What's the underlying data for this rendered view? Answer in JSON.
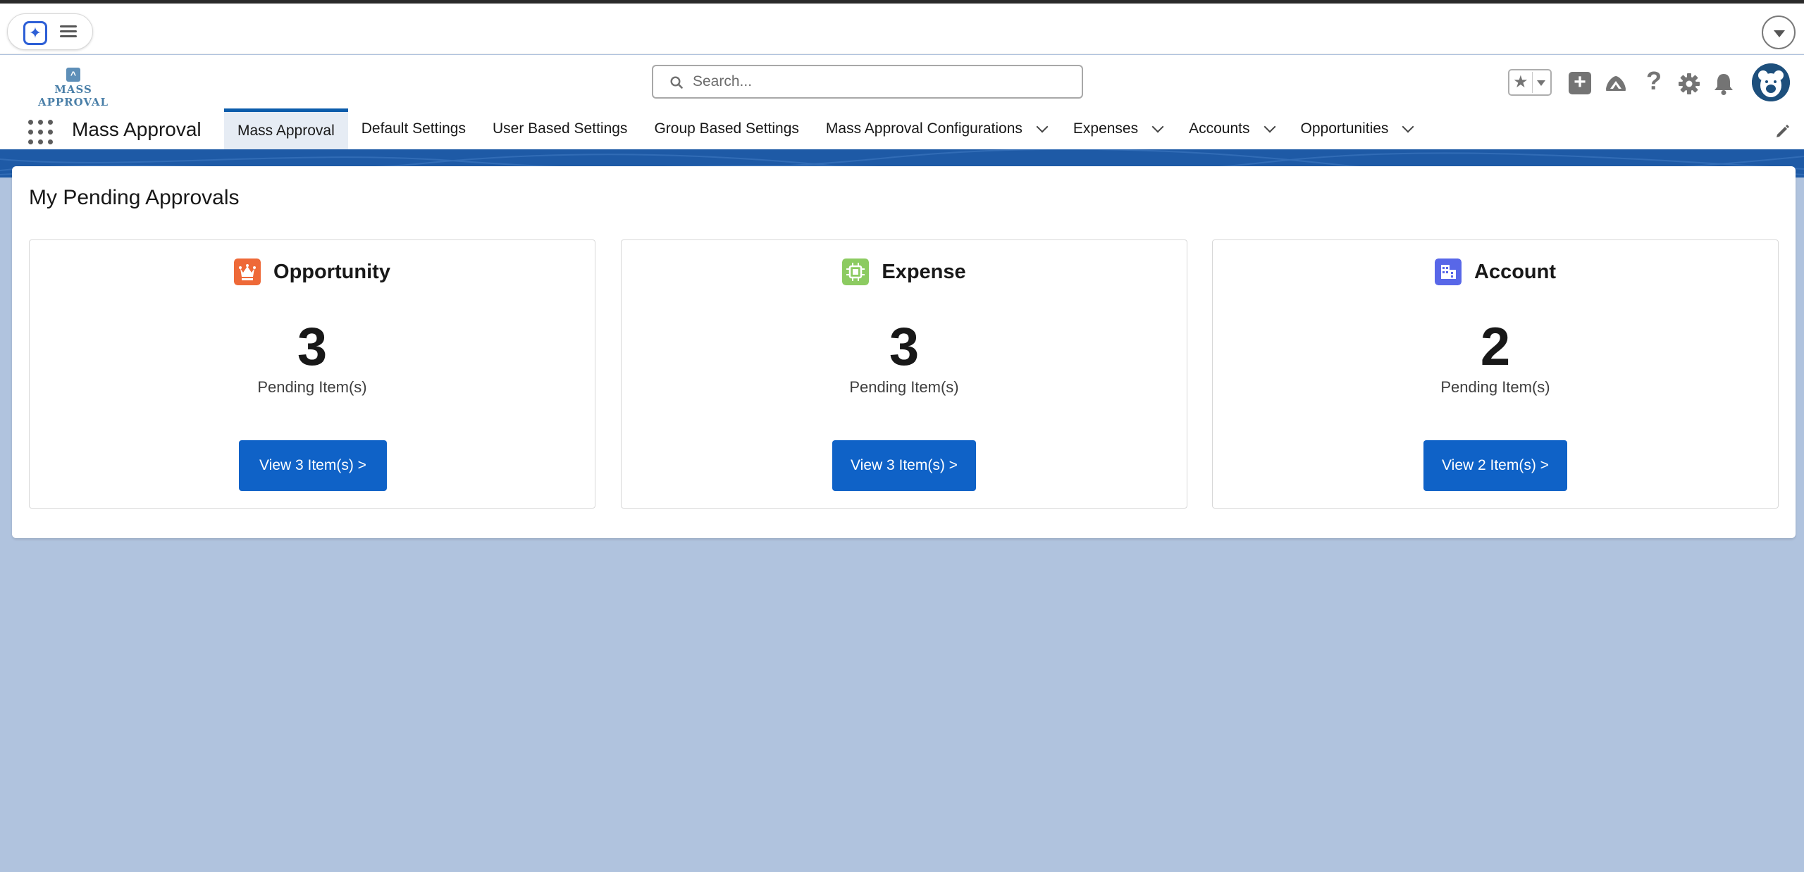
{
  "browser": {
    "extension_icon": "sparkle-logo-icon",
    "menu_icon": "hamburger-icon",
    "dropdown_icon": "chevron-down-circle-icon"
  },
  "header": {
    "logo_text": "MASS APPROVAL",
    "search_placeholder": "Search...",
    "icons": [
      "star-icon",
      "plus-icon",
      "trailhead-icon",
      "help-icon",
      "gear-icon",
      "bell-icon",
      "avatar"
    ]
  },
  "nav": {
    "app_name": "Mass Approval",
    "tabs": [
      {
        "label": "Mass Approval",
        "active": true,
        "dropdown": false
      },
      {
        "label": "Default Settings",
        "active": false,
        "dropdown": false
      },
      {
        "label": "User Based Settings",
        "active": false,
        "dropdown": false
      },
      {
        "label": "Group Based Settings",
        "active": false,
        "dropdown": false
      },
      {
        "label": "Mass Approval Configurations",
        "active": false,
        "dropdown": true
      },
      {
        "label": "Expenses",
        "active": false,
        "dropdown": true
      },
      {
        "label": "Accounts",
        "active": false,
        "dropdown": true
      },
      {
        "label": "Opportunities",
        "active": false,
        "dropdown": true
      }
    ]
  },
  "main": {
    "title": "My Pending Approvals",
    "tiles": [
      {
        "name": "Opportunity",
        "icon": "crown-icon",
        "icon_color": "#ee6938",
        "count": "3",
        "caption": "Pending Item(s)",
        "button": "View 3 Item(s) >"
      },
      {
        "name": "Expense",
        "icon": "chip-icon",
        "icon_color": "#8ccb61",
        "count": "3",
        "caption": "Pending Item(s)",
        "button": "View 3 Item(s) >"
      },
      {
        "name": "Account",
        "icon": "building-icon",
        "icon_color": "#5867e8",
        "count": "2",
        "caption": "Pending Item(s)",
        "button": "View 2 Item(s) >"
      }
    ]
  },
  "colors": {
    "brand_blue": "#0f62c7",
    "page_bg": "#b0c3de",
    "banner": "#1e5aa6"
  }
}
